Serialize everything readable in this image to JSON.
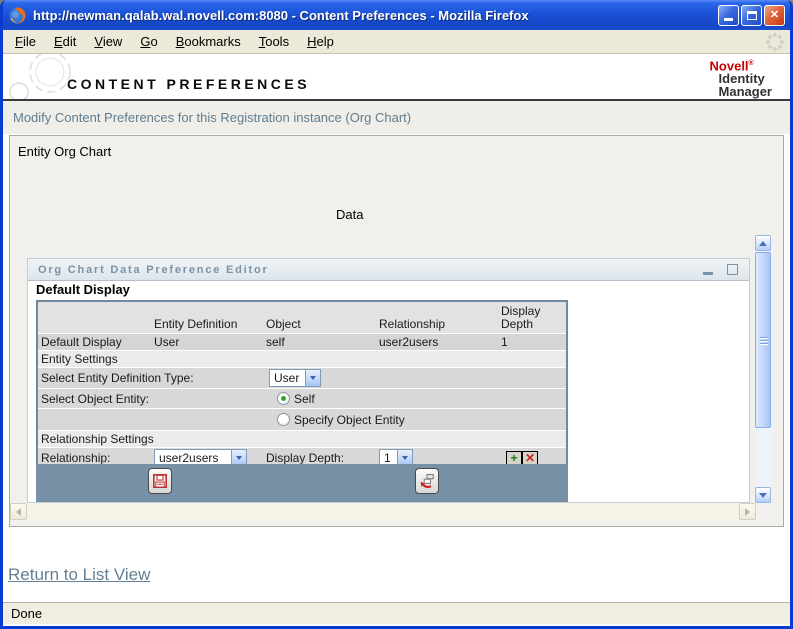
{
  "window": {
    "title": "http://newman.qalab.wal.novell.com:8080 - Content Preferences - Mozilla Firefox",
    "status": "Done",
    "close_glyph": "✕"
  },
  "menubar": {
    "items": [
      {
        "mnemonic": "F",
        "rest": "ile"
      },
      {
        "mnemonic": "E",
        "rest": "dit"
      },
      {
        "mnemonic": "V",
        "rest": "iew"
      },
      {
        "mnemonic": "G",
        "rest": "o"
      },
      {
        "mnemonic": "B",
        "rest": "ookmarks"
      },
      {
        "mnemonic": "T",
        "rest": "ools"
      },
      {
        "mnemonic": "H",
        "rest": "elp"
      }
    ]
  },
  "header": {
    "title": "CONTENT PREFERENCES",
    "brand": {
      "name": "Novell",
      "registered": "®",
      "line1": "Identity",
      "line2": "Manager"
    }
  },
  "subtitle": {
    "text": "Modify Content Preferences for this Registration instance (Org Chart)"
  },
  "main": {
    "section_label": "Entity Org Chart",
    "data_label": "Data",
    "return_link": "Return to List View"
  },
  "editor": {
    "title": "Org Chart Data Preference Editor",
    "heading": "Default Display",
    "table": {
      "headers": {
        "entity_definition": "Entity Definition",
        "object": "Object",
        "relationship": "Relationship",
        "display_depth": "Display Depth"
      },
      "default_row": {
        "label": "Default Display",
        "entity_definition": "User",
        "object": "self",
        "relationship": "user2users",
        "display_depth": "1"
      },
      "entity_section_label": "Entity Settings",
      "relationship_section_label": "Relationship Settings",
      "entity_type": {
        "label": "Select Entity Definition Type:",
        "value": "User"
      },
      "object_entity": {
        "label": "Select Object Entity:",
        "option_self": "Self",
        "option_specify": "Specify Object Entity"
      },
      "relationship": {
        "label": "Relationship:",
        "value": "user2users"
      },
      "display_depth": {
        "label": "Display Depth:",
        "value": "1"
      }
    },
    "icons": {
      "add_glyph": "+",
      "delete_glyph": "✕"
    }
  },
  "colors": {
    "titlebar_blue": "#1b52d9",
    "novell_red": "#cc0000",
    "steel_blue_footer": "#7890a6",
    "table_border_blue": "#7189a0",
    "xp_beige": "#ece9d8",
    "subtitle_text": "#5f7d90"
  }
}
